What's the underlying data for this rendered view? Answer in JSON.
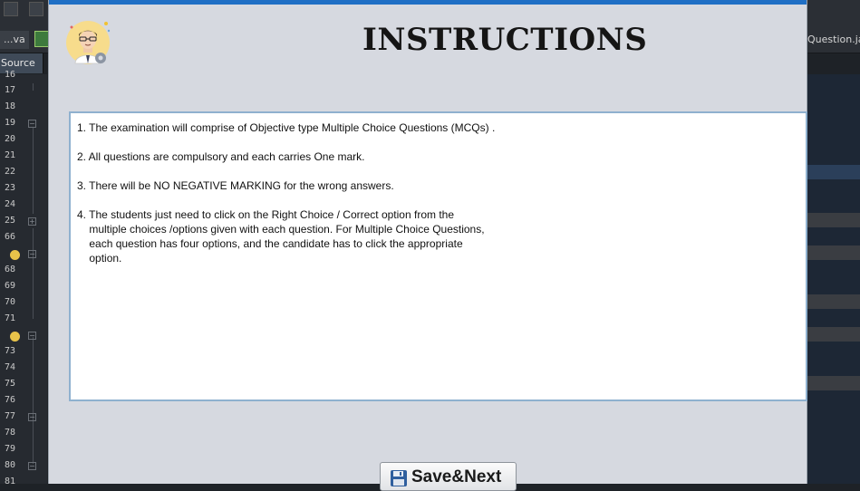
{
  "ide": {
    "tab_left_label": "...va",
    "tab_right_label": "Question.java",
    "source_tab_label": "Source",
    "line_numbers": [
      "16",
      "17",
      "18",
      "19",
      "20",
      "21",
      "22",
      "23",
      "24",
      "25",
      "66",
      "",
      "68",
      "69",
      "70",
      "71",
      "",
      "73",
      "74",
      "75",
      "76",
      "77",
      "78",
      "79",
      "80",
      "81"
    ]
  },
  "dialog": {
    "title": "INSTRUCTIONS",
    "instructions": [
      "1. The examination will comprise of Objective type Multiple Choice Questions (MCQs) .",
      "2. All questions are compulsory and each carries One mark.",
      "3. There will be NO NEGATIVE MARKING for the wrong answers.",
      "4. The students just need to click on the Right Choice / Correct option from the\n    multiple choices /options given with each question. For Multiple Choice Questions,\n    each question has four options, and the candidate has to click the appropriate\n    option."
    ],
    "save_next_label": "Save&Next"
  },
  "colors": {
    "dialog_background": "#d6d9e0",
    "title_bar_accent": "#1f6fc5",
    "text_area_border": "#8fb1cf"
  },
  "icons": {
    "avatar": "user-avatar-icon",
    "save": "floppy-disk-icon"
  }
}
